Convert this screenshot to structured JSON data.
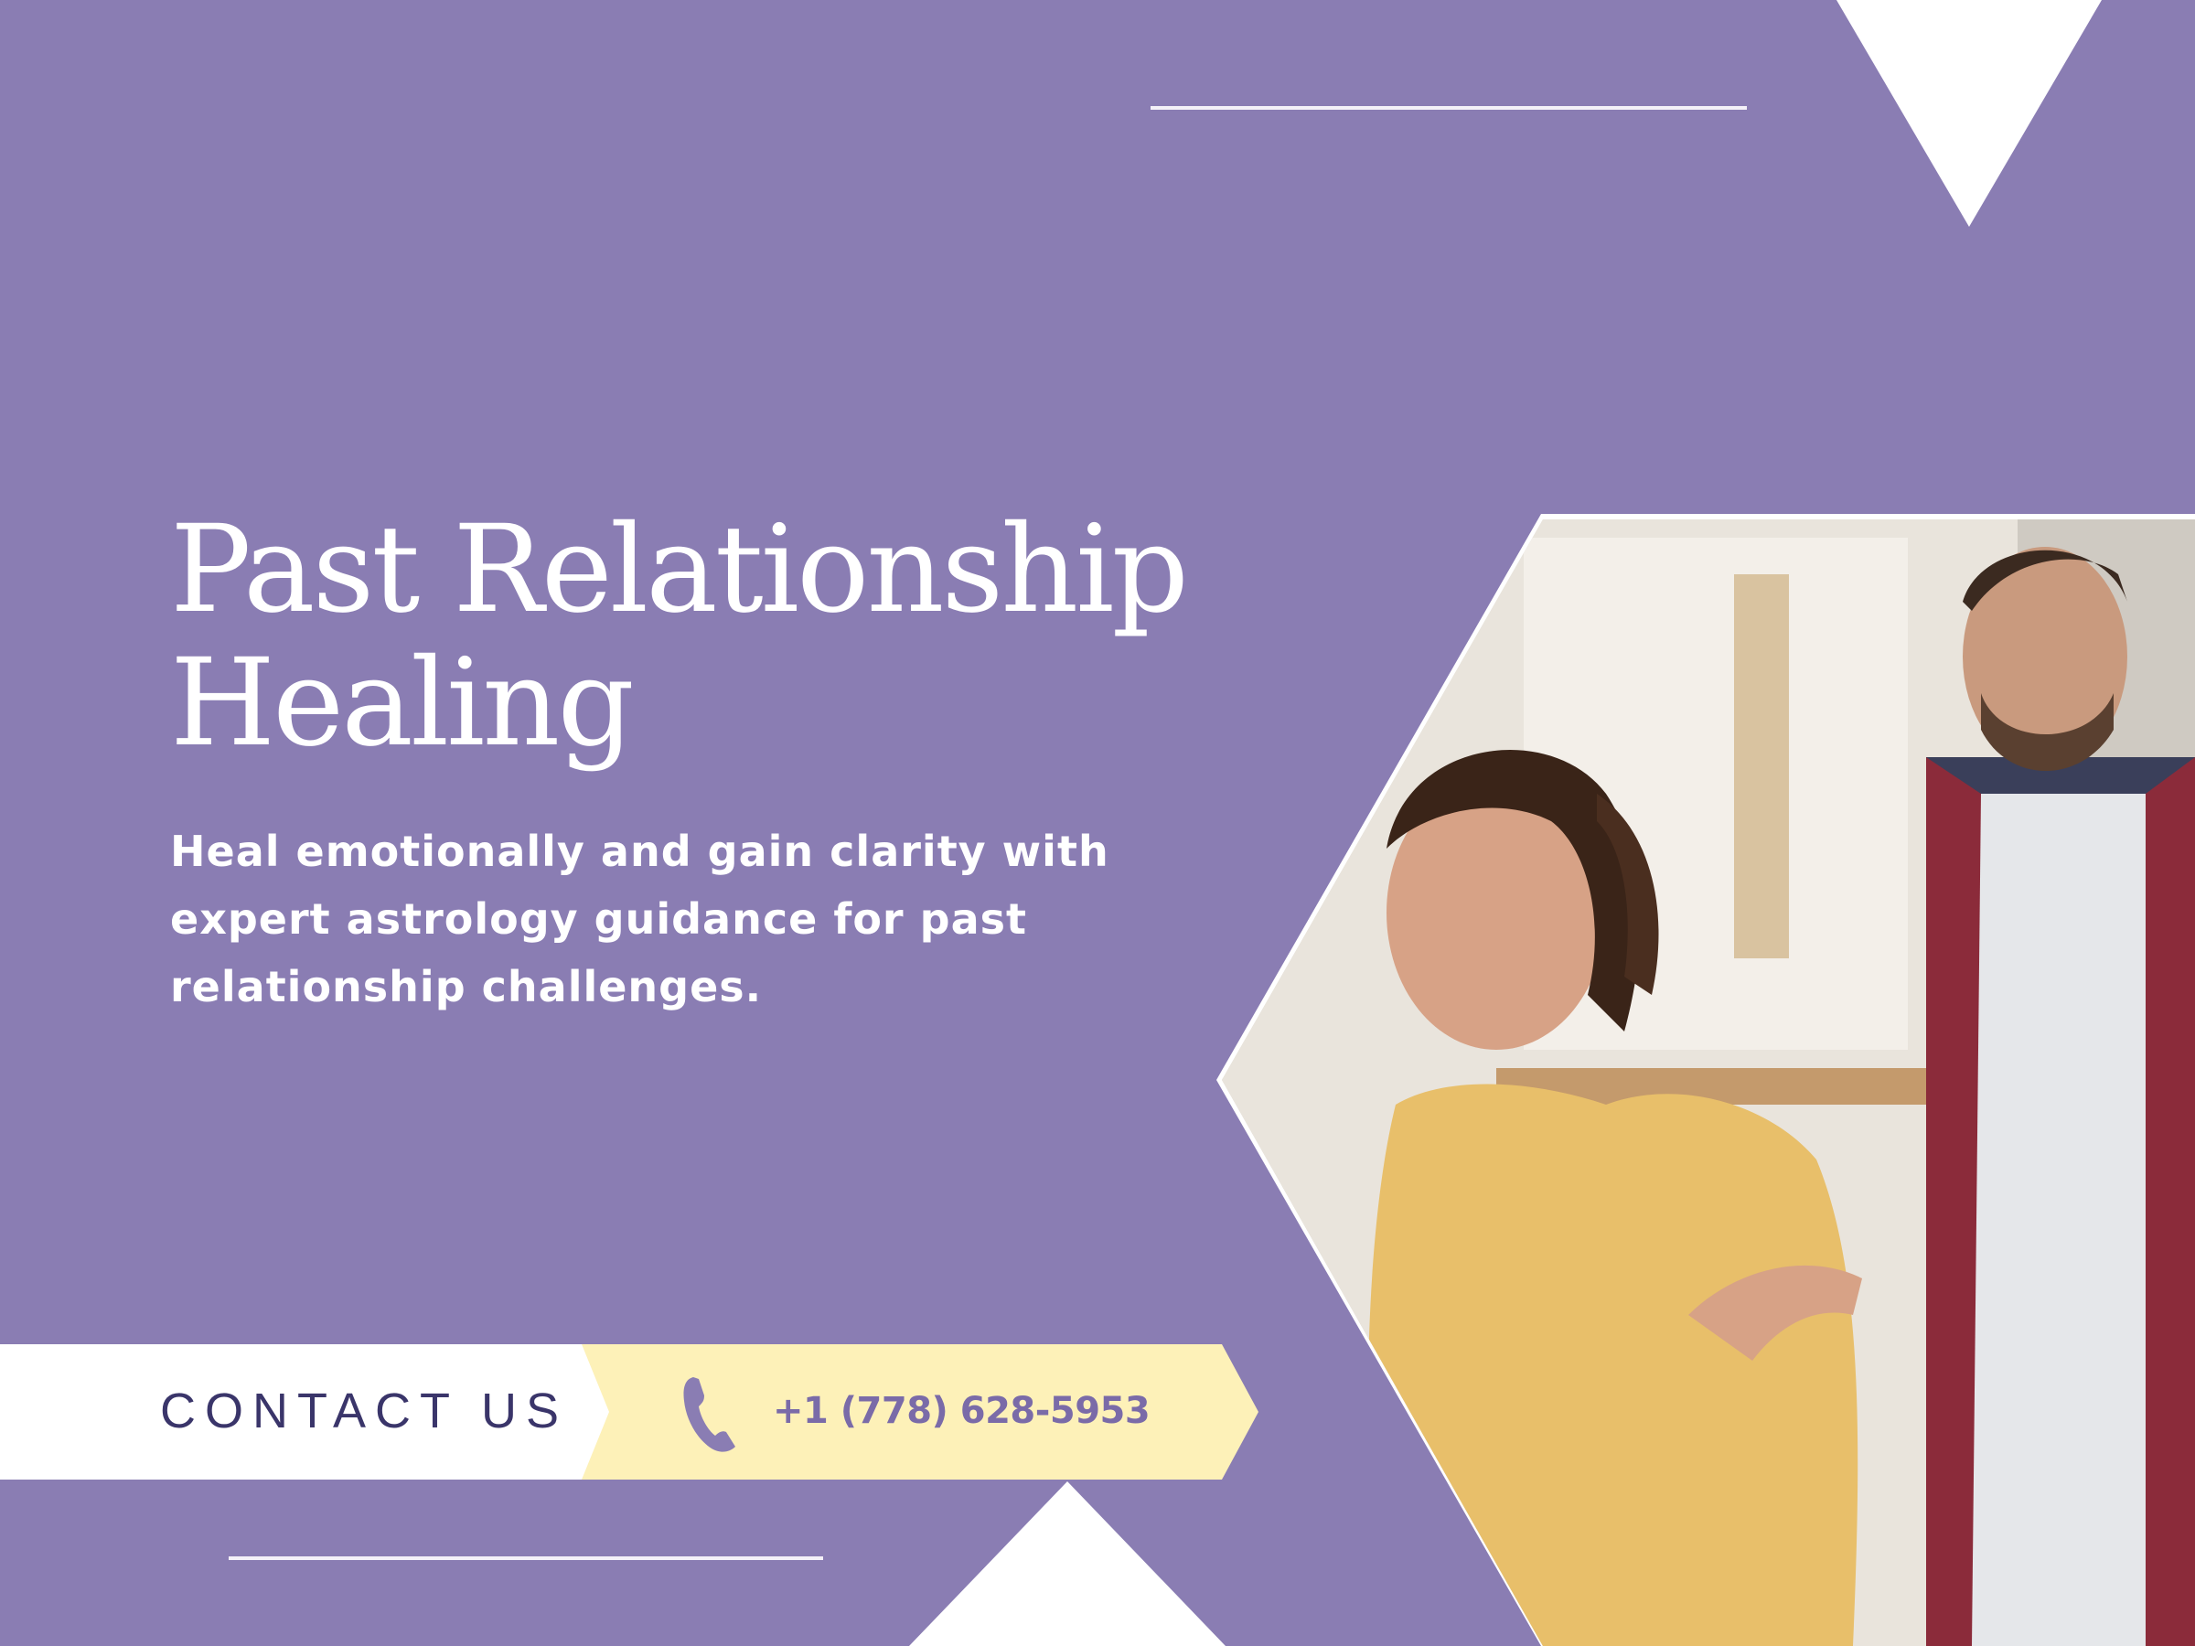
{
  "hero": {
    "title_line1": "Past Relationship",
    "title_line2": "Healing",
    "subtitle_line1": "Heal emotionally and gain clarity with",
    "subtitle_line2": "expert astrology guidance for past",
    "subtitle_line3": "relationship challenges."
  },
  "contact": {
    "label": "CONTACT US",
    "phone": "+1 (778) 628-5953",
    "icon": "phone-icon"
  },
  "photo": {
    "alt": "Couple in a kitchen, woman upset and gesturing, man looking down"
  },
  "colors": {
    "background": "#8a7db3",
    "contact_band": "#ffffff",
    "phone_band": "#fdf1b8",
    "accent_text": "#3a356a"
  }
}
